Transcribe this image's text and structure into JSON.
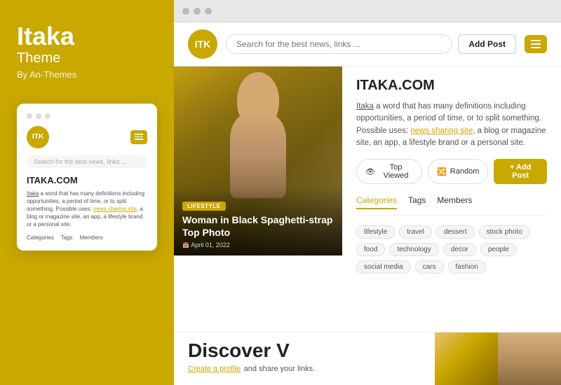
{
  "left": {
    "title": "Itaka",
    "subtitle": "Theme",
    "by": "By An-Themes",
    "logo": "ITK",
    "mini_search_placeholder": "Search for the best news, links ...",
    "mini_site_title": "ITAKA.COM",
    "mini_body_text": "Itaka a word that has many definitions including opportunities, a period of time, or to split something. Possible uses: news sharing site, a blog or magazine site, an app, a lifestyle brand or a personal site.",
    "mini_link": "news sharing site",
    "mini_tabs": [
      "Categories",
      "Tags",
      "Members"
    ]
  },
  "browser": {
    "dots": [
      "dot1",
      "dot2",
      "dot3"
    ]
  },
  "site": {
    "logo": "ITK",
    "search_placeholder": "Search for the best news, links ...",
    "add_post_label": "Add Post",
    "hero": {
      "badge": "LIFESTYLE",
      "title": "Woman in Black Spaghetti-strap Top Photo",
      "date": "April 01, 2022"
    },
    "info": {
      "site_name": "ITAKA.COM",
      "description_part1": "Itaka",
      "description_part2": " a word that has many definitions including opportunities, a period of time, or to split something. Possible uses: ",
      "link": "news sharing site",
      "description_part3": ", a blog or magazine site, an app, a lifestyle brand or a personal site.",
      "btn_top_viewed": "Top Viewed",
      "btn_random": "Random",
      "btn_add_post": "+ Add Post",
      "tabs": [
        "Categories",
        "Tags",
        "Members"
      ],
      "active_tab": "Categories",
      "tags": [
        "lifestyle",
        "travel",
        "dessert",
        "stock photo",
        "food",
        "technology",
        "decor",
        "people",
        "social media",
        "cars",
        "fashion"
      ]
    },
    "discover": {
      "heading": "Discover V",
      "sub": "Create a profile",
      "sub_rest": " and share your links."
    }
  }
}
